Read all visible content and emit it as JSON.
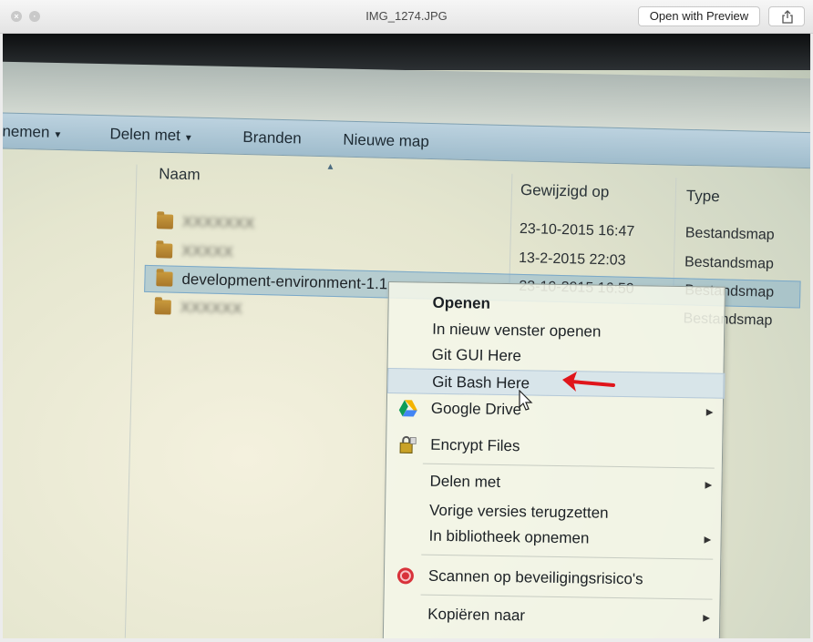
{
  "window": {
    "title": "IMG_1274.JPG",
    "open_with_preview": "Open with Preview"
  },
  "toolbar": {
    "items": [
      "nemen",
      "Delen met",
      "Branden",
      "Nieuwe map"
    ]
  },
  "columns": {
    "name": "Naam",
    "modified": "Gewijzigd op",
    "type": "Type"
  },
  "rows": [
    {
      "name": "XXXXXXX",
      "date": "23-10-2015 16:47",
      "type": "Bestandsmap"
    },
    {
      "name": "XXXXX",
      "date": "13-2-2015 22:03",
      "type": "Bestandsmap"
    },
    {
      "name": "development-environment-1.1",
      "date": "23-10-2015 16:50",
      "type": "Bestandsmap"
    },
    {
      "name": "XXXXXX",
      "date": "",
      "type": "Bestandsmap"
    }
  ],
  "context_menu": {
    "items": [
      {
        "label": "Openen"
      },
      {
        "label": "In nieuw venster openen"
      },
      {
        "label": "Git GUI Here"
      },
      {
        "label": "Git Bash Here"
      },
      {
        "label": "Google Drive"
      },
      {
        "label": "Encrypt Files"
      },
      {
        "label": "Delen met"
      },
      {
        "label": "Vorige versies terugzetten"
      },
      {
        "label": "In bibliotheek opnemen"
      },
      {
        "label": "Scannen op beveiligingsrisico's"
      },
      {
        "label": "Kopiëren naar"
      }
    ]
  },
  "colors": {
    "annotation_arrow": "#e0151b",
    "selection": "#7aa8c8",
    "toolbar": "#a9c4d3"
  }
}
